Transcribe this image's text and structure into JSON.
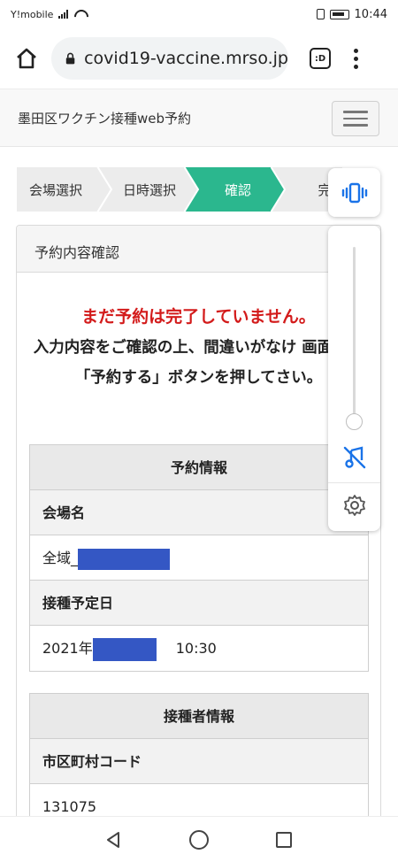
{
  "status_bar": {
    "carrier": "Y!mobile",
    "time": "10:44"
  },
  "browser": {
    "url": "covid19-vaccine.mrso.jp",
    "tabs_label": ":D"
  },
  "site": {
    "title": "墨田区ワクチン接種web予約"
  },
  "steps": [
    {
      "label": "会場選択",
      "active": false
    },
    {
      "label": "日時選択",
      "active": false
    },
    {
      "label": "確認",
      "active": true
    },
    {
      "label": "完",
      "active": false
    }
  ],
  "colors": {
    "active_step": "#2bb78e",
    "warning": "#d31b1b",
    "volume_accent": "#1a73e8",
    "redaction": "#3457c4"
  },
  "card": {
    "header": "予約内容確認",
    "warning": "まだ予約は完了していません。",
    "instruction": "入力内容をご確認の上、間違いがなけ 画面下の「予約する」ボタンを押してさい。",
    "reservation": {
      "heading": "予約情報",
      "venue_label": "会場名",
      "venue_value": "全域_",
      "date_label": "接種予定日",
      "date_prefix": "2021年",
      "time": "10:30"
    },
    "person": {
      "heading": "接種者情報",
      "municipality_label": "市区町村コード",
      "municipality_value": "131075"
    }
  },
  "volume_panel": {
    "mode_icon": "vibrate-icon",
    "mute_icon": "music-off-icon",
    "settings_icon": "gear-icon",
    "level": 0
  }
}
